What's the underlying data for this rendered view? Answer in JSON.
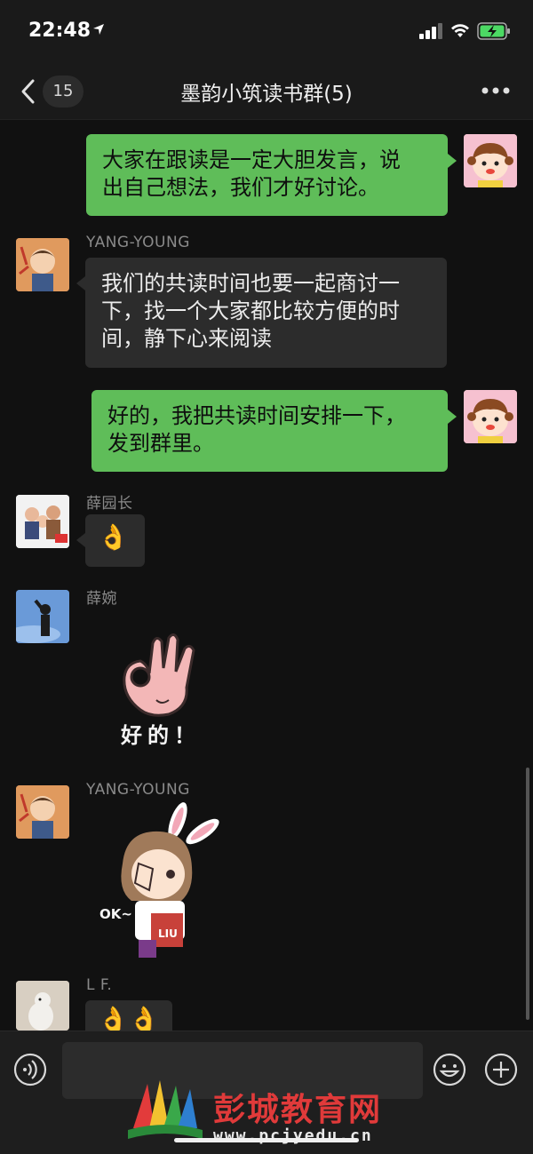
{
  "status_bar": {
    "time": "22:48",
    "icons": [
      "location-arrow-icon",
      "signal-icon",
      "wifi-icon",
      "battery-charging-icon"
    ]
  },
  "nav": {
    "unread_count": "15",
    "title": "墨韵小筑读书群(5)"
  },
  "messages": [
    {
      "direction": "outgoing",
      "type": "text",
      "lines": [
        "大家在跟读是一定大胆发言，说",
        "出自己想法，我们才好讨论。"
      ]
    },
    {
      "direction": "incoming",
      "type": "text",
      "sender": "YANG-YOUNG",
      "lines": [
        "我们的共读时间也要一起商讨一",
        "下，找一个大家都比较方便的时",
        "间，静下心来阅读"
      ]
    },
    {
      "direction": "outgoing",
      "type": "text",
      "lines": [
        "好的，我把共读时间安排一下，",
        "发到群里。"
      ]
    },
    {
      "direction": "incoming",
      "type": "emoji",
      "sender": "薛园长",
      "emoji": "👌"
    },
    {
      "direction": "incoming",
      "type": "sticker",
      "sender": "薛婉",
      "sticker_text": "好的！"
    },
    {
      "direction": "incoming",
      "type": "sticker",
      "sender": "YANG-YOUNG",
      "sticker_text": "OK~",
      "sticker_label": "LIU"
    },
    {
      "direction": "incoming",
      "type": "emoji",
      "sender": "L F.",
      "emoji": "👌👌"
    }
  ],
  "input_bar": {
    "placeholder": "",
    "icons": [
      "voice-icon",
      "emoji-icon",
      "plus-icon"
    ]
  },
  "watermark": {
    "title": "彭城教育网",
    "url": "www.pcjyedu.cn"
  },
  "colors": {
    "background": "#111111",
    "outgoing_bubble": "#5fbd59",
    "incoming_bubble": "#2c2c2c",
    "watermark_red": "#e03a3a"
  }
}
